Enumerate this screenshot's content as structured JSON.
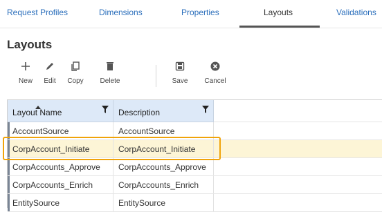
{
  "tabs": [
    {
      "label": "Request Profiles"
    },
    {
      "label": "Dimensions"
    },
    {
      "label": "Properties"
    },
    {
      "label": "Layouts",
      "active": true
    },
    {
      "label": "Validations"
    }
  ],
  "page": {
    "title": "Layouts"
  },
  "toolbar": {
    "new_label": "New",
    "edit_label": "Edit",
    "copy_label": "Copy",
    "delete_label": "Delete",
    "save_label": "Save",
    "cancel_label": "Cancel"
  },
  "grid": {
    "columns": [
      {
        "label": "Layout Name",
        "sorted": "ascending",
        "filter_icon": "filter-icon"
      },
      {
        "label": "Description",
        "filter_icon": "filter-icon"
      }
    ],
    "rows": [
      {
        "name": "AccountSource",
        "description": "AccountSource"
      },
      {
        "name": "CorpAccount_Initiate",
        "description": "CorpAccount_Initiate",
        "selected": true
      },
      {
        "name": "CorpAccounts_Approve",
        "description": "CorpAccounts_Approve"
      },
      {
        "name": "CorpAccounts_Enrich",
        "description": "CorpAccounts_Enrich"
      },
      {
        "name": "EntitySource",
        "description": "EntitySource"
      }
    ]
  },
  "colors": {
    "link": "#2a6ebb",
    "header_bg": "#dde9f8",
    "selected_row_bg": "#fdf5d6",
    "highlight": "#f0a30a"
  }
}
